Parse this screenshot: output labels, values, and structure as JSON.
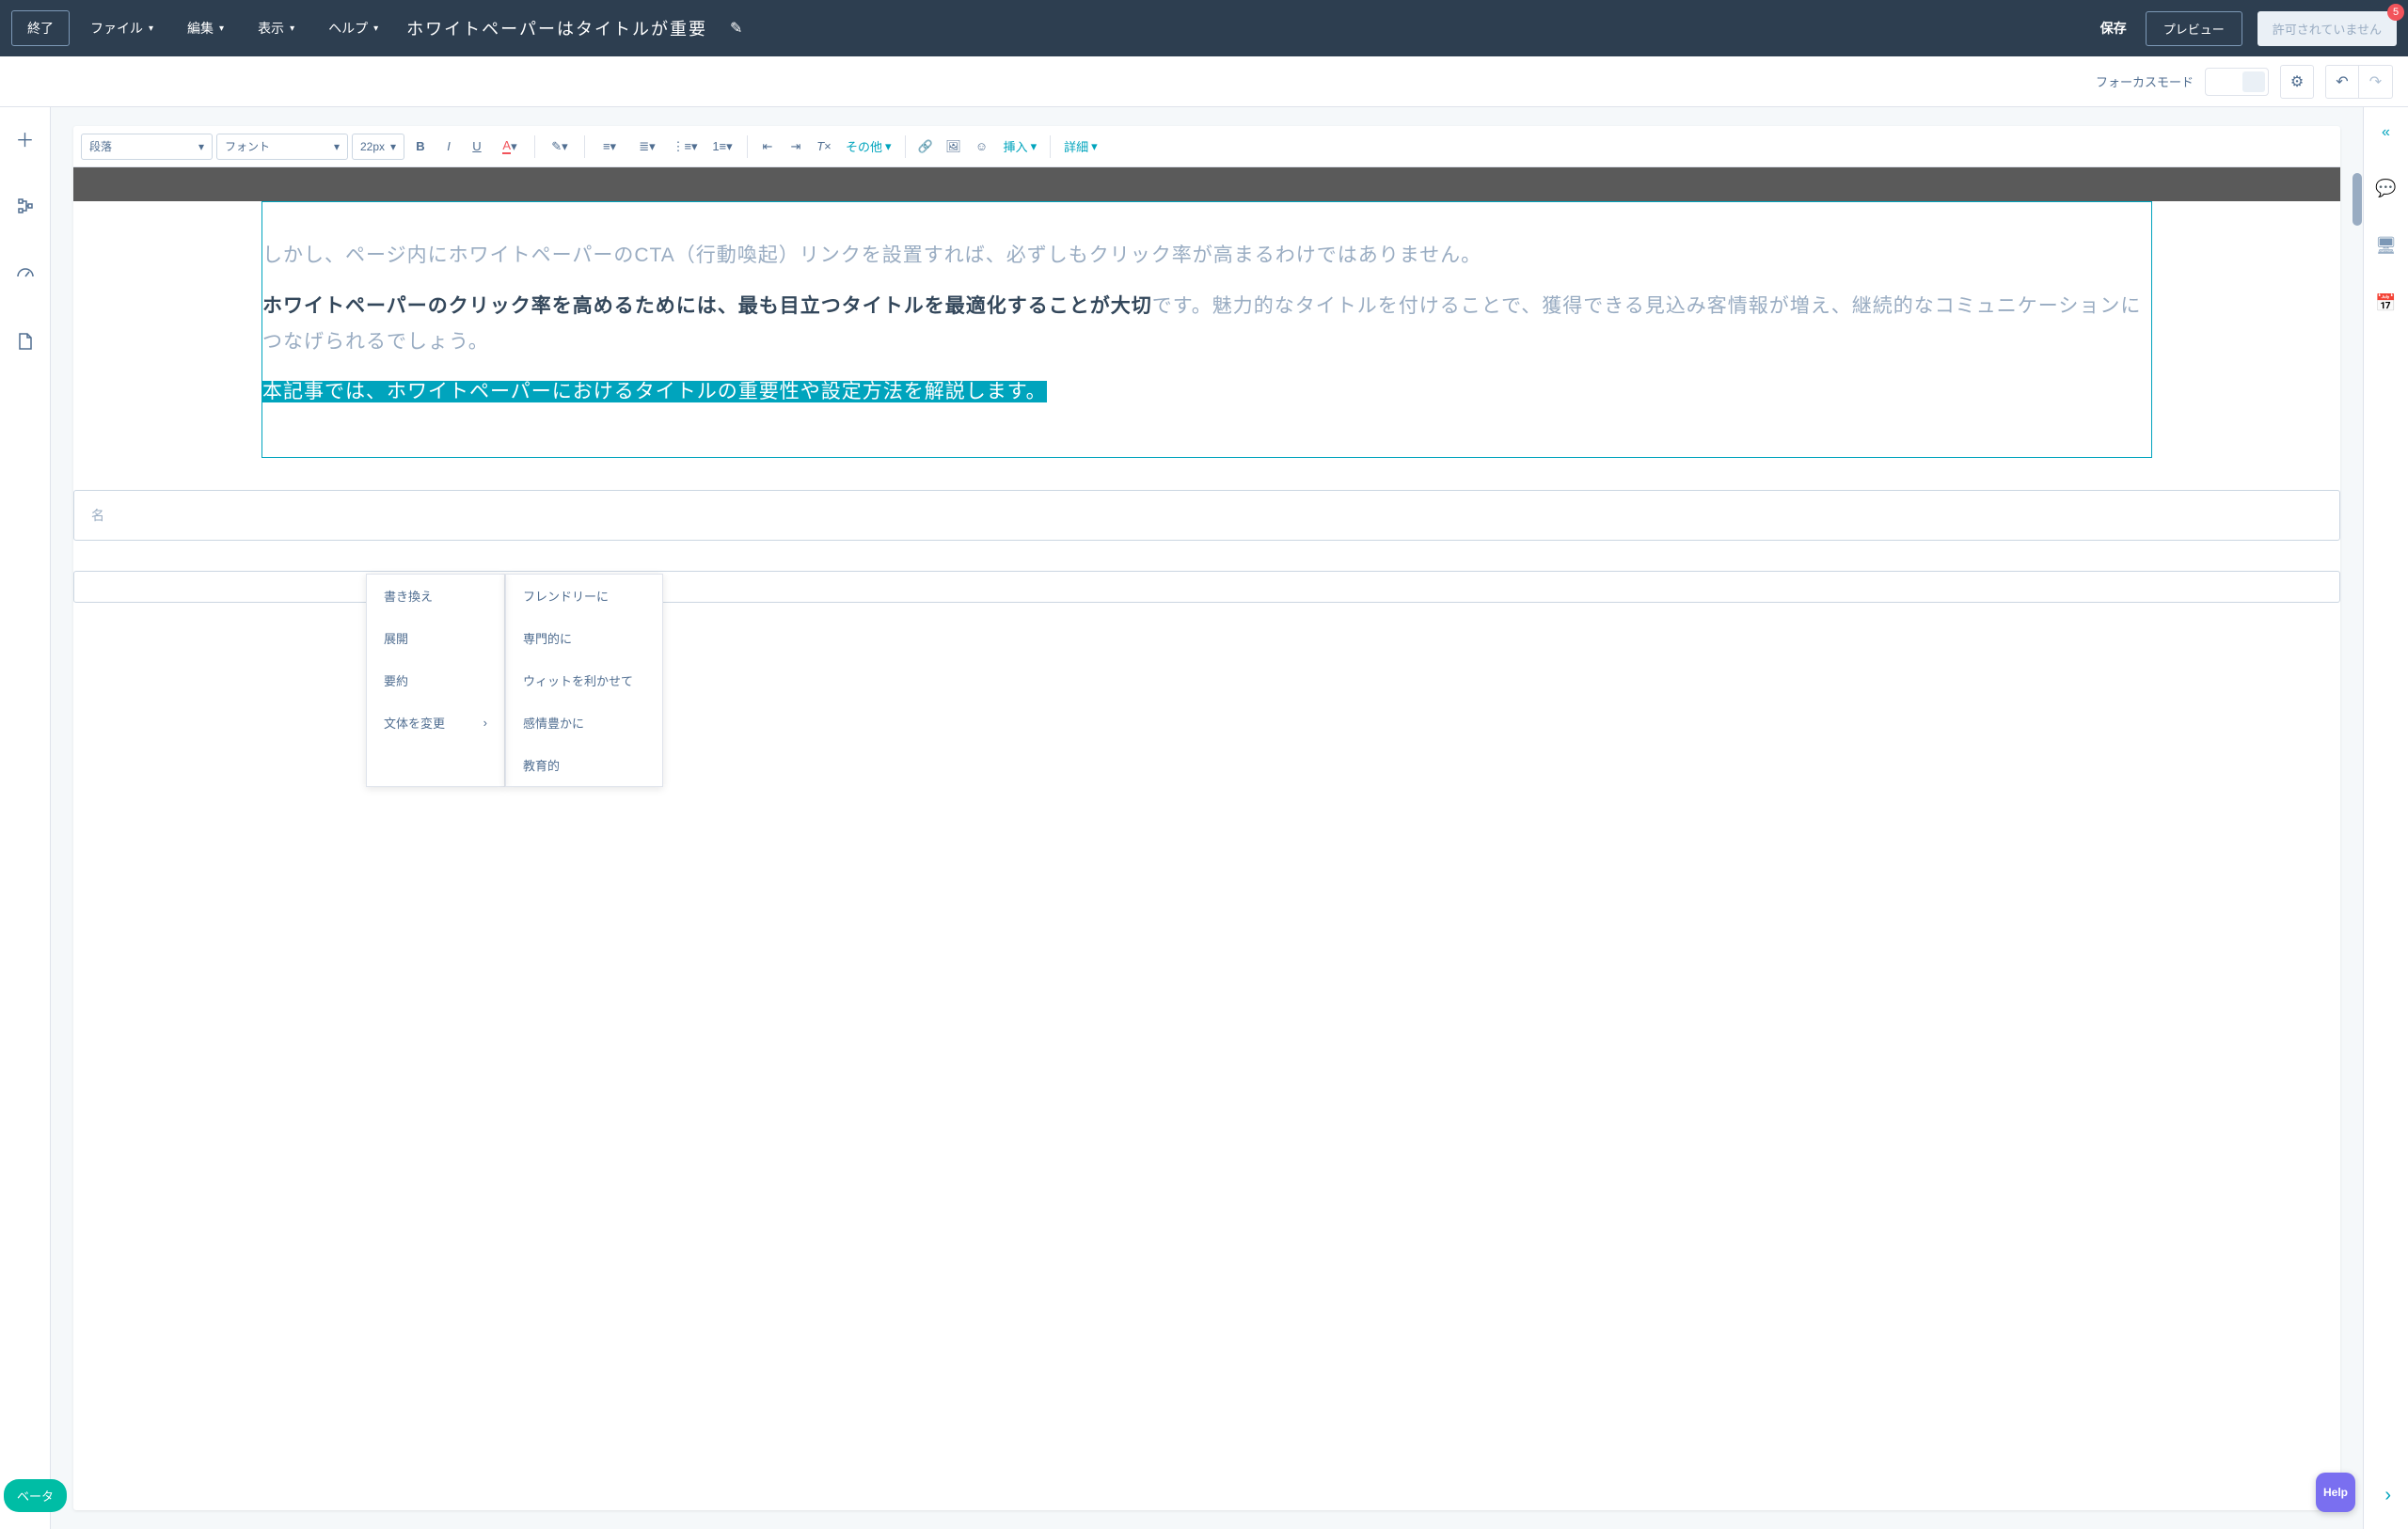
{
  "header": {
    "exit": "終了",
    "menus": {
      "file": "ファイル",
      "edit": "編集",
      "view": "表示",
      "help": "ヘルプ"
    },
    "title": "ホワイトペーパーはタイトルが重要",
    "save": "保存",
    "preview": "プレビュー",
    "disabled": "許可されていません",
    "badge": "5"
  },
  "subbar": {
    "focus_mode": "フォーカスモード"
  },
  "toolbar": {
    "paragraph": "段落",
    "font": "フォント",
    "size": "22px",
    "other": "その他",
    "insert": "挿入",
    "details": "詳細"
  },
  "content": {
    "p1": "しかし、ページ内にホワイトペーパーのCTA（行動喚起）リンクを設置すれば、必ずしもクリック率が高まるわけではありません。",
    "p2_bold": "ホワイトペーパーのクリック率を高めるためには、最も目立つタイトルを最適化することが大切",
    "p2_rest": "です。魅力的なタイトルを付けることで、獲得できる見込み客情報が増え、継続的なコミュニケーションにつなげられるでしょう。",
    "p3": "本記事では、ホワイトペーパーにおけるタイトルの重要性や設定方法を解説します。"
  },
  "context_menu": {
    "col1": {
      "rewrite": "書き換え",
      "expand": "展開",
      "summarize": "要約",
      "change_style": "文体を変更"
    },
    "col2": {
      "friendly": "フレンドリーに",
      "professional": "専門的に",
      "witty": "ウィットを利かせて",
      "emotional": "感情豊かに",
      "educational": "教育的"
    }
  },
  "form": {
    "name": "名"
  },
  "fixed": {
    "beta": "ベータ",
    "help": "Help"
  }
}
